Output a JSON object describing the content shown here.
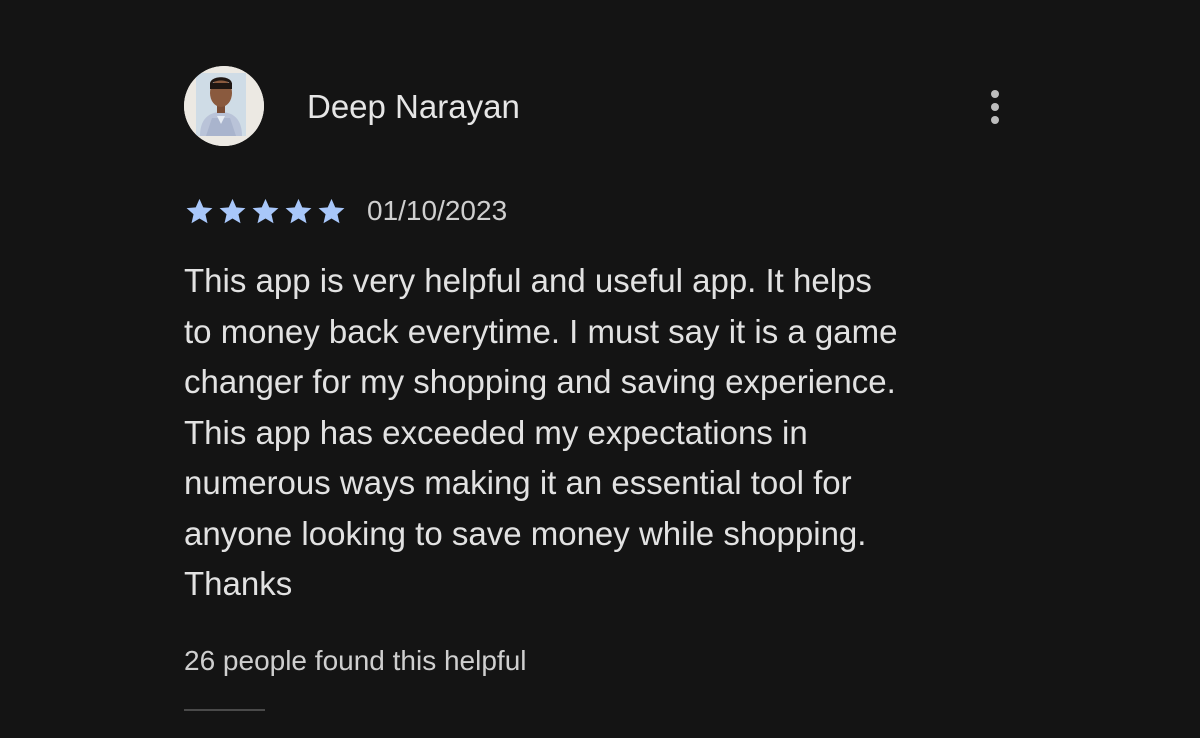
{
  "review": {
    "reviewer_name": "Deep Narayan",
    "avatar_icon": "profile-photo",
    "more_icon": "more-vertical-icon",
    "rating": 5,
    "rating_max": 5,
    "star_color": "#a8c7fa",
    "date": "01/10/2023",
    "text_lines": [
      "This app is very helpful and useful app. It helps",
      "to money back everytime. I must say it is a game",
      "changer for my shopping and saving experience.",
      "This app has exceeded my expectations in",
      "numerous ways making it an essential tool for",
      "anyone looking to save money while shopping.",
      "Thanks"
    ],
    "helpful_text": "26 people found this helpful"
  }
}
